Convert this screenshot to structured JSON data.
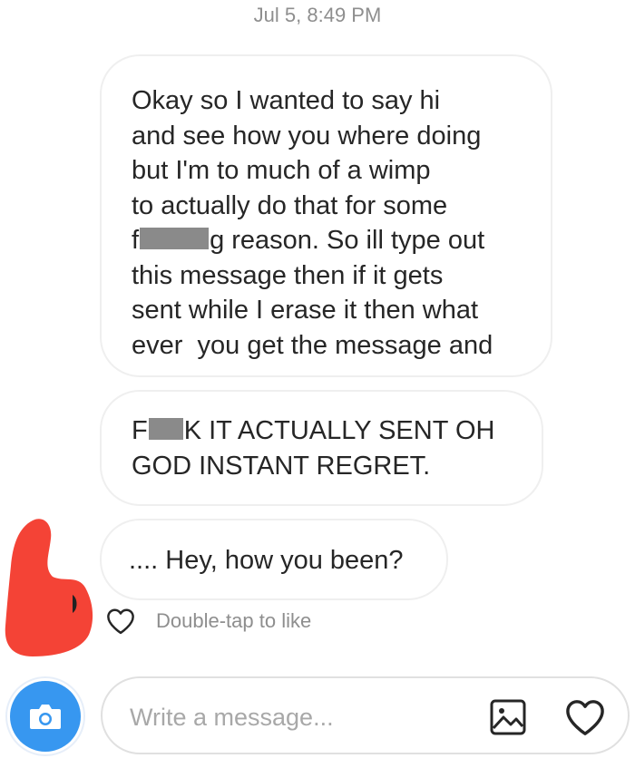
{
  "thread": {
    "timestamp": "Jul 5, 8:49 PM",
    "messages": [
      {
        "lines": [
          "Okay so I wanted to say hi",
          "and see how you where doing",
          "but I'm to much of a wimp",
          "to actually do that for some",
          {
            "before": "f",
            "after": "g reason. So ill type out"
          },
          "this message then if it gets",
          "sent while I erase it then what",
          "ever  you get the message and"
        ]
      },
      {
        "lines": [
          {
            "before": "F",
            "after": "K IT ACTUALLY SENT OH"
          },
          "GOD INSTANT REGRET."
        ]
      },
      {
        "lines": [
          ".... Hey, how you been?"
        ]
      }
    ],
    "like_hint": "Double-tap to like"
  },
  "composer": {
    "placeholder": "Write a message...",
    "camera_icon": "camera-icon",
    "gallery_icon": "gallery-icon",
    "heart_icon": "heart-icon"
  },
  "colors": {
    "accent": "#3797f0",
    "bubble_border": "#efefef",
    "muted_text": "#8e8e8e",
    "redaction": "#8a8a8a",
    "scribble": "#f44336"
  }
}
